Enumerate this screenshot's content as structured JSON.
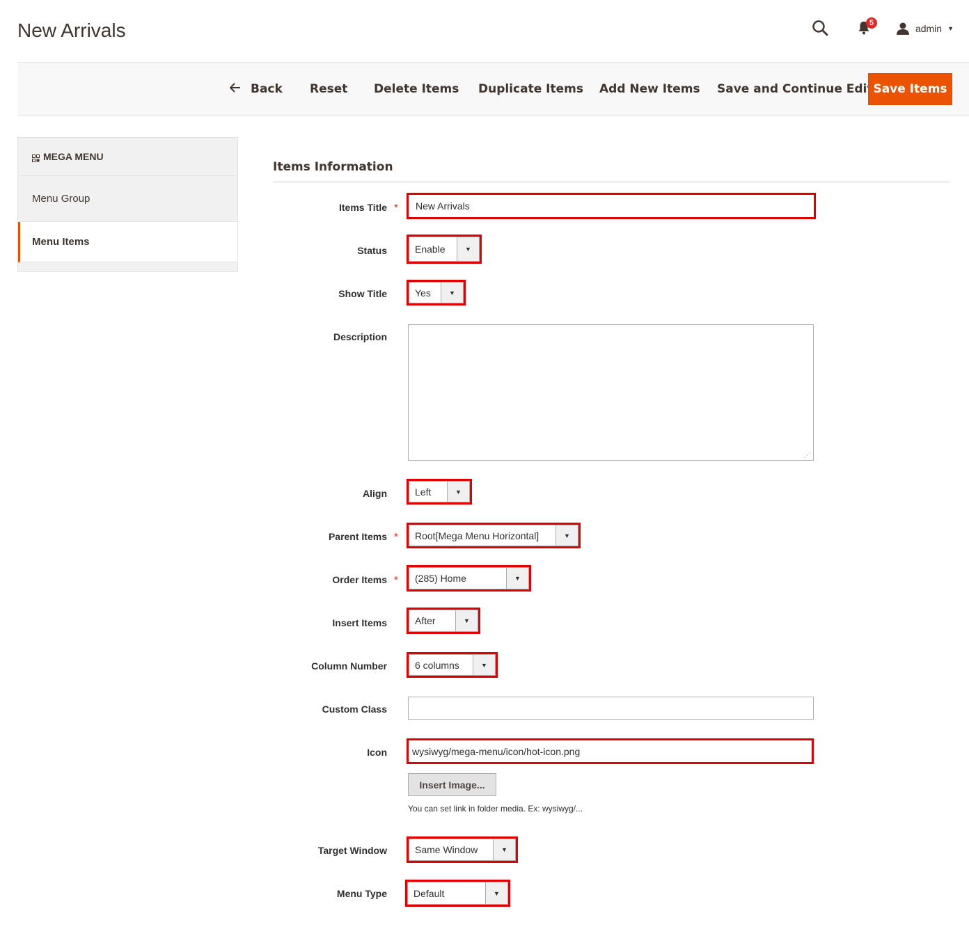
{
  "header": {
    "page_title": "New Arrivals",
    "notifications_count": "5",
    "user_name": "admin"
  },
  "toolbar": {
    "back_label": "Back",
    "reset_label": "Reset",
    "delete_label": "Delete Items",
    "duplicate_label": "Duplicate Items",
    "add_new_label": "Add New Items",
    "save_continue_label": "Save and Continue Edit",
    "save_label": "Save Items"
  },
  "sidebar": {
    "title": "MEGA MENU",
    "items": [
      {
        "label": "Menu Group",
        "active": false
      },
      {
        "label": "Menu Items",
        "active": true
      }
    ]
  },
  "form": {
    "section_title": "Items Information",
    "items_title": {
      "label": "Items Title",
      "value": "New Arrivals",
      "required": true
    },
    "status": {
      "label": "Status",
      "value": "Enable"
    },
    "show_title": {
      "label": "Show Title",
      "value": "Yes"
    },
    "description": {
      "label": "Description",
      "value": ""
    },
    "align": {
      "label": "Align",
      "value": "Left"
    },
    "parent_items": {
      "label": "Parent Items",
      "value": "Root[Mega Menu Horizontal]",
      "required": true
    },
    "order_items": {
      "label": "Order Items",
      "value": "(285) Home",
      "required": true
    },
    "insert_items": {
      "label": "Insert Items",
      "value": "After"
    },
    "column_number": {
      "label": "Column Number",
      "value": "6 columns"
    },
    "custom_class": {
      "label": "Custom Class",
      "value": ""
    },
    "icon": {
      "label": "Icon",
      "value": "wysiwyg/mega-menu/icon/hot-icon.png",
      "button": "Insert Image...",
      "note": "You can set link in folder media. Ex: wysiwyg/..."
    },
    "target_window": {
      "label": "Target Window",
      "value": "Same Window"
    },
    "menu_type": {
      "label": "Menu Type",
      "value": "Default"
    },
    "required_mark": "*"
  },
  "colors": {
    "accent": "#eb5202",
    "highlight": "#e30000",
    "badge": "#e22626"
  }
}
